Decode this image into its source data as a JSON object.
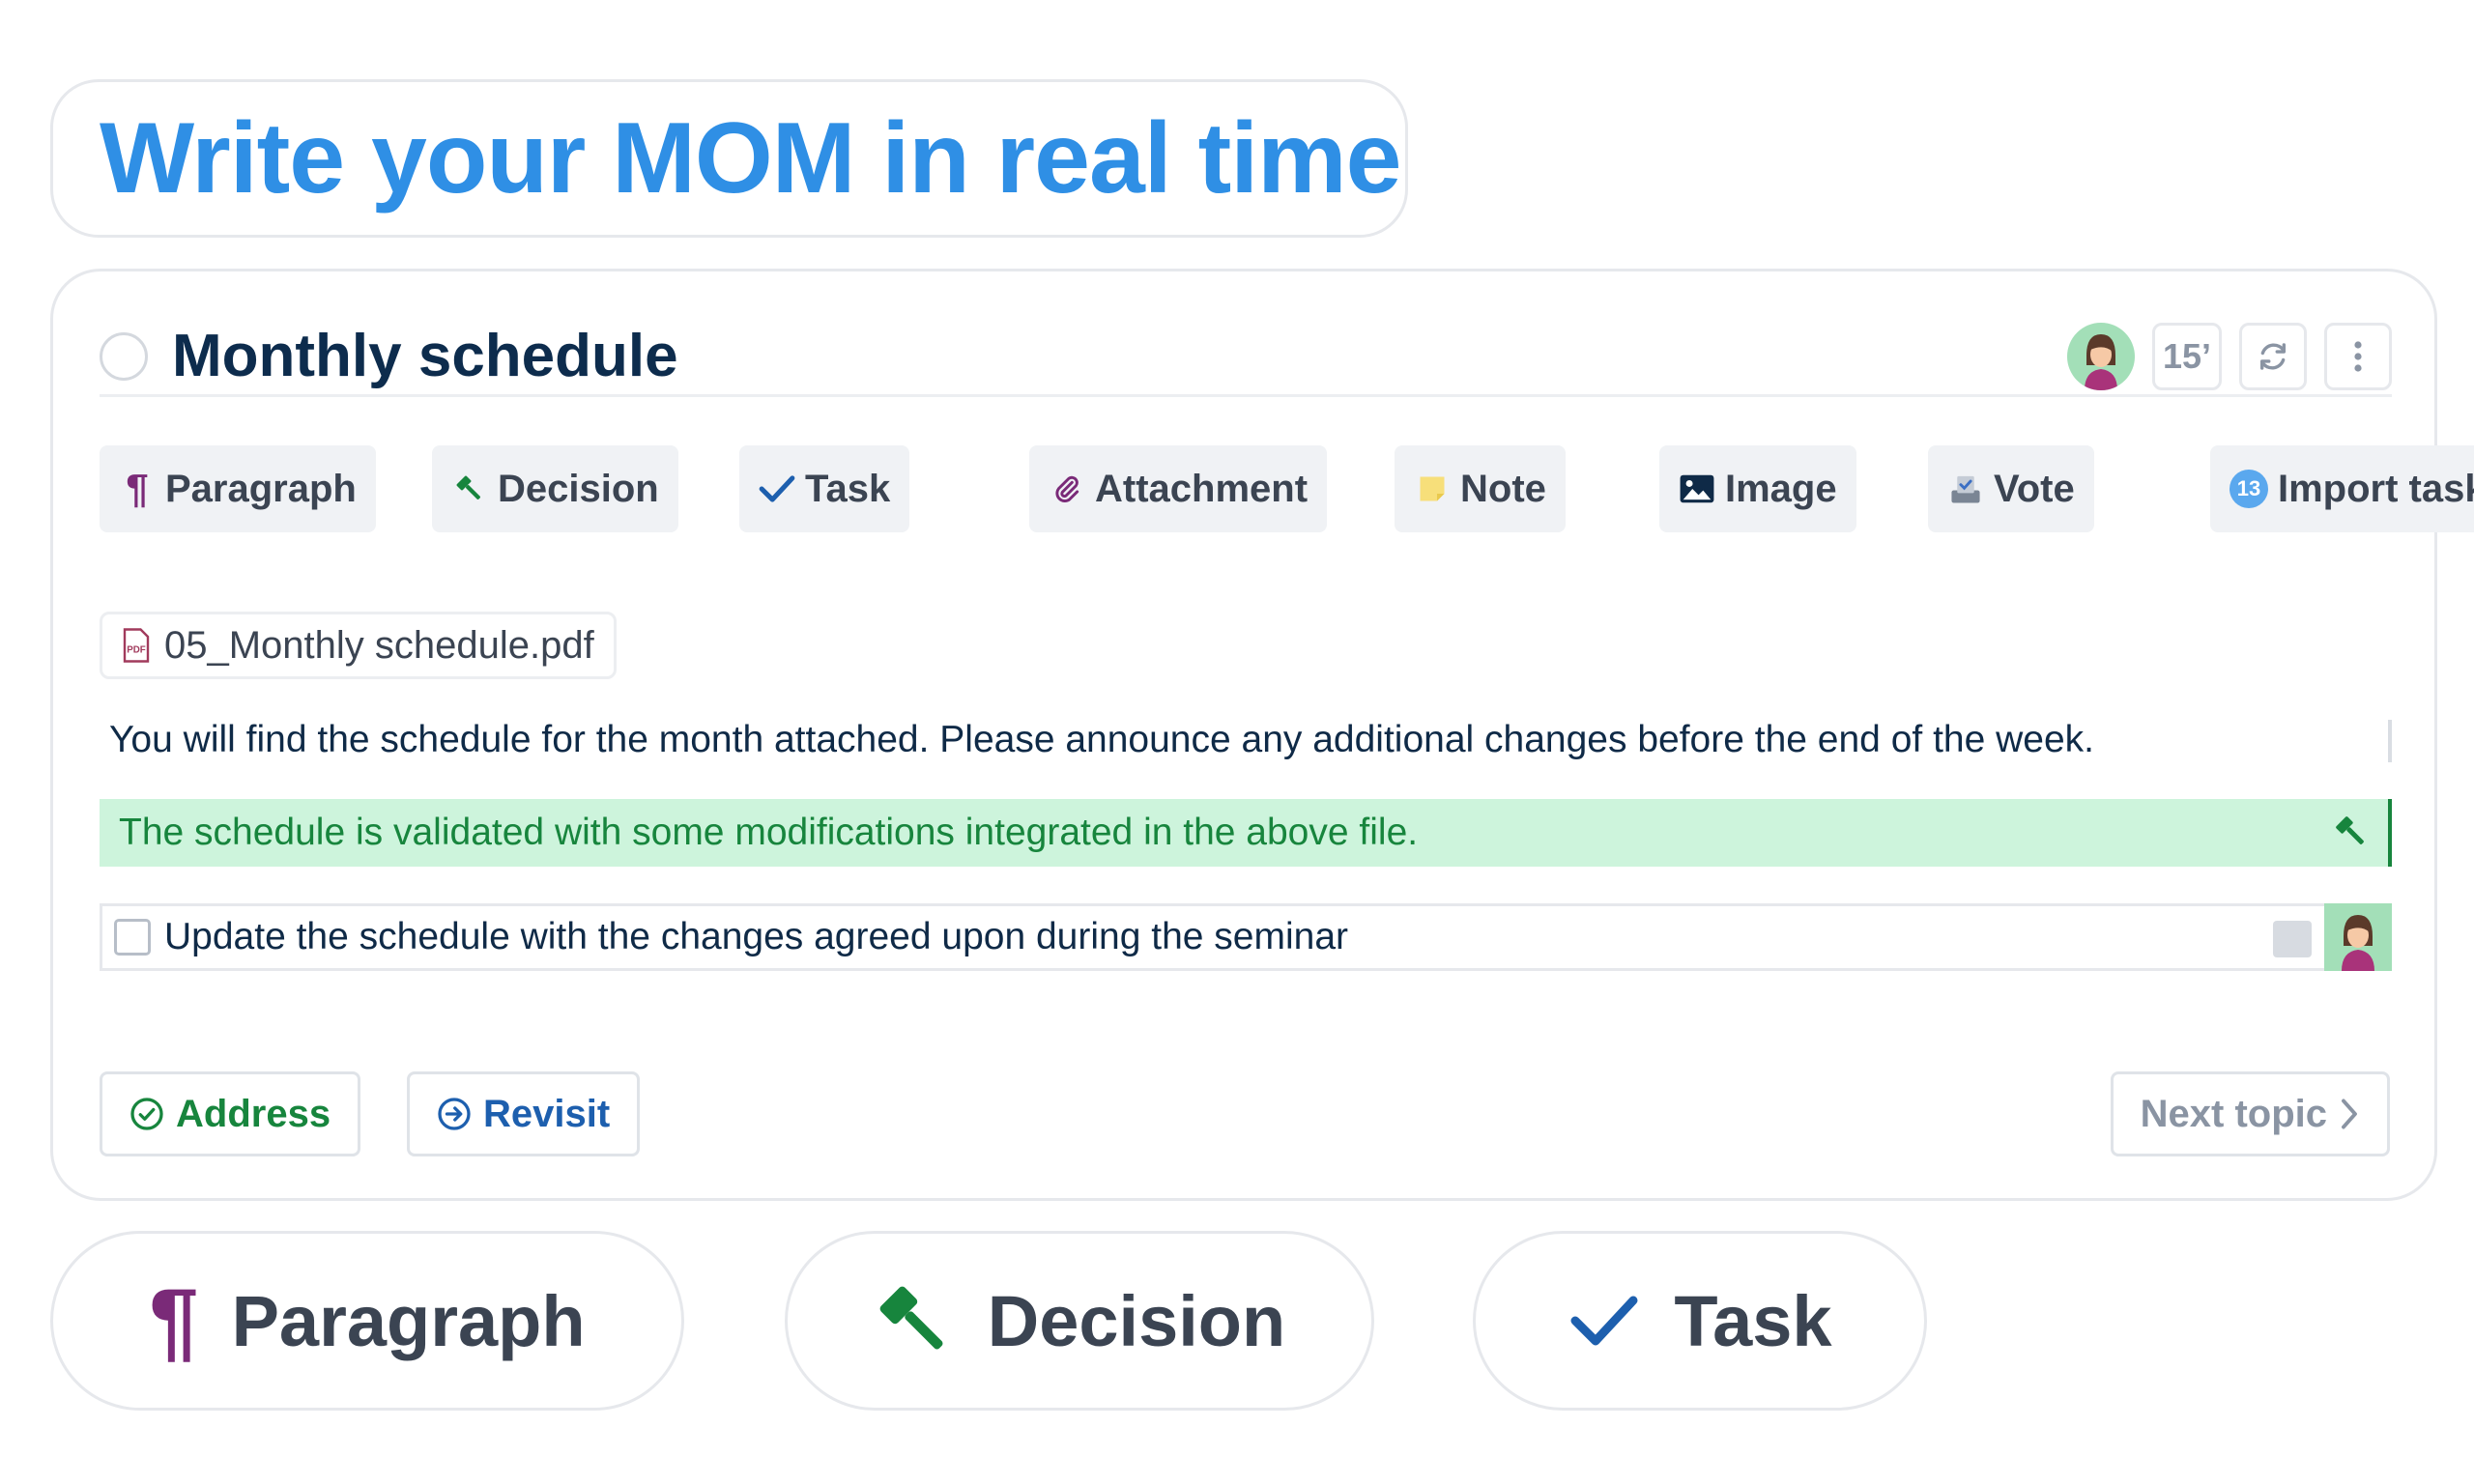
{
  "headline": "Write your MOM in real time",
  "topic": {
    "title": "Monthly schedule",
    "duration": "15’"
  },
  "toolbar": {
    "paragraph": "Paragraph",
    "decision": "Decision",
    "task": "Task",
    "attachment": "Attachment",
    "note": "Note",
    "image": "Image",
    "vote": "Vote",
    "import_tasks": "Import tasks",
    "import_count": "13"
  },
  "content": {
    "attachment_name": "05_Monthly schedule.pdf",
    "attachment_type_label": "PDF",
    "paragraph_text": "You will find the schedule for the month attached. Please announce any additional changes before the end of the week.",
    "decision_text": "The schedule is validated with some modifications integrated in the above file.",
    "task_text": "Update the schedule with the changes agreed upon during the seminar"
  },
  "footer": {
    "address": "Address",
    "revisit": "Revisit",
    "next_topic": "Next topic"
  },
  "feature_pills": {
    "paragraph": "Paragraph",
    "decision": "Decision",
    "task": "Task"
  },
  "colors": {
    "headline_blue": "#2f8fe5",
    "paragraph_purple": "#7a2a78",
    "decision_green": "#17853d",
    "task_blue": "#1d5fae",
    "decision_highlight": "#cdf4dc",
    "note_yellow": "#f7df7a"
  },
  "icons": [
    "pilcrow-icon",
    "gavel-icon",
    "check-icon",
    "paperclip-icon",
    "note-icon",
    "image-icon",
    "ballot-box-icon",
    "import-badge-icon",
    "pdf-file-icon",
    "refresh-icon",
    "more-vertical-icon",
    "check-circle-icon",
    "arrow-circle-icon",
    "chevron-right-icon"
  ]
}
